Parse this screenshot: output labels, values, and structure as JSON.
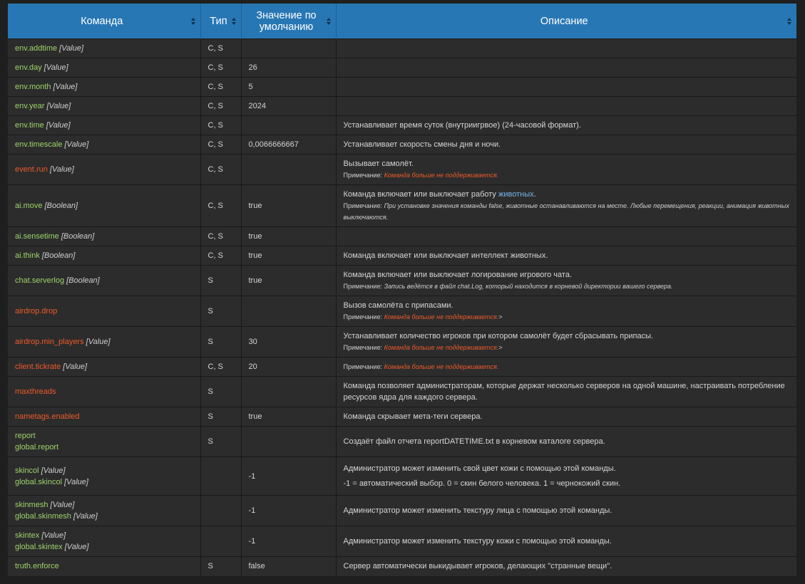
{
  "columns": [
    "Команда",
    "Тип",
    "Значение по умолчанию",
    "Описание"
  ],
  "rows": [
    {
      "h": 27,
      "cmds": [
        {
          "name": "env.addtime",
          "arg": "[Value]",
          "dep": false
        }
      ],
      "type": "C, S",
      "def": "",
      "desc": []
    },
    {
      "h": 27,
      "cmds": [
        {
          "name": "env.day",
          "arg": "[Value]",
          "dep": false
        }
      ],
      "type": "C, S",
      "def": "26",
      "desc": []
    },
    {
      "h": 27,
      "cmds": [
        {
          "name": "env.month",
          "arg": "[Value]",
          "dep": false
        }
      ],
      "type": "C, S",
      "def": "5",
      "desc": []
    },
    {
      "h": 27,
      "cmds": [
        {
          "name": "env.year",
          "arg": "[Value]",
          "dep": false
        }
      ],
      "type": "C, S",
      "def": "2024",
      "desc": []
    },
    {
      "h": 27,
      "cmds": [
        {
          "name": "env.time",
          "arg": "[Value]",
          "dep": false
        }
      ],
      "type": "C, S",
      "def": "",
      "desc": [
        {
          "t": "Устанавливает время суток (внутриигрвое) (24-часовой формат)."
        }
      ]
    },
    {
      "h": 27,
      "cmds": [
        {
          "name": "env.timescale",
          "arg": "[Value]",
          "dep": false
        }
      ],
      "type": "C, S",
      "def": "0,0066666667",
      "desc": [
        {
          "t": "Устанавливает скорость смены дня и ночи."
        }
      ]
    },
    {
      "h": 43,
      "cmds": [
        {
          "name": "event.run",
          "arg": "[Value]",
          "dep": true
        }
      ],
      "type": "C, S",
      "def": "",
      "desc": [
        {
          "t": "Вызывает самолёт."
        },
        {
          "note": "Примечание: ",
          "warn": "Команда больше не поддерживается.",
          "gt": ""
        }
      ]
    },
    {
      "h": 59,
      "cmds": [
        {
          "name": "ai.move",
          "arg": "[Boolean]",
          "dep": false
        }
      ],
      "type": "C, S",
      "def": "true",
      "desc": [
        {
          "t": "Команда включает или выключает работу ",
          "link": "животных",
          "after": "."
        },
        {
          "note": "Примечание: ",
          "it": "При установке значения команды false, животные останавливаются на месте. Любые перемещения, реакции, анимация животных выключаются."
        }
      ]
    },
    {
      "h": 27,
      "cmds": [
        {
          "name": "ai.sensetime",
          "arg": "[Boolean]",
          "dep": false
        }
      ],
      "type": "C, S",
      "def": "true",
      "desc": []
    },
    {
      "h": 27,
      "cmds": [
        {
          "name": "ai.think",
          "arg": "[Boolean]",
          "dep": false
        }
      ],
      "type": "C, S",
      "def": "true",
      "desc": [
        {
          "t": "Команда включает или выключает интеллект животных."
        }
      ]
    },
    {
      "h": 43,
      "cmds": [
        {
          "name": "chat.serverlog",
          "arg": "[Boolean]",
          "dep": false
        }
      ],
      "type": "S",
      "def": "true",
      "desc": [
        {
          "t": "Команда включает или выключает логирование игрового чата."
        },
        {
          "note": "Примечание: ",
          "it": "Запись ведётся в файл chat.Log, который находится в корневой директории вашего сервера."
        }
      ]
    },
    {
      "h": 43,
      "cmds": [
        {
          "name": "airdrop.drop",
          "arg": "",
          "dep": true
        }
      ],
      "type": "S",
      "def": "",
      "desc": [
        {
          "t": "Вызов самолёта с припасами."
        },
        {
          "note": "Примечание: ",
          "warn": "Команда больше не поддерживается.",
          "gt": ">"
        }
      ]
    },
    {
      "h": 43,
      "cmds": [
        {
          "name": "airdrop.min_players",
          "arg": "[Value]",
          "dep": true
        }
      ],
      "type": "S",
      "def": "30",
      "desc": [
        {
          "t": "Устанавливает количество игроков при котором самолёт будет сбрасывать припасы."
        },
        {
          "note": "Примечание: ",
          "warn": "Команда больше не поддерживается.",
          "gt": ">"
        }
      ]
    },
    {
      "h": 27,
      "cmds": [
        {
          "name": "client.tickrate",
          "arg": "[Value]",
          "dep": true
        }
      ],
      "type": "C, S",
      "def": "20",
      "desc": [
        {
          "note": "Примечание: ",
          "warn": "Команда больше не поддерживается.",
          "gt": ""
        }
      ]
    },
    {
      "h": 43,
      "cmds": [
        {
          "name": "maxthreads",
          "arg": "",
          "dep": true
        }
      ],
      "type": "S",
      "def": "",
      "desc": [
        {
          "t": "Команда позволяет администраторам, которые держат несколько серверов на одной машине, настраивать потребление ресурсов ядра для каждого сервера."
        }
      ]
    },
    {
      "h": 27,
      "cmds": [
        {
          "name": "nametags.enabled",
          "arg": "",
          "dep": true
        }
      ],
      "type": "S",
      "def": "true",
      "desc": [
        {
          "t": "Команда скрывает мета-теги сервера."
        }
      ]
    },
    {
      "h": 43,
      "cmds": [
        {
          "name": "report",
          "arg": "",
          "dep": false
        },
        {
          "name": "global.report",
          "arg": "",
          "dep": false
        }
      ],
      "type": "S",
      "def": "",
      "desc": [
        {
          "t": "Создаёт файл отчета reportDATETIME.txt в корневом каталоге сервера."
        }
      ]
    },
    {
      "h": 54,
      "cmds": [
        {
          "name": "skincol",
          "arg": "[Value]",
          "dep": false
        },
        {
          "name": "global.skincol",
          "arg": "[Value]",
          "dep": false
        }
      ],
      "type": "",
      "def": "-1",
      "desc": [
        {
          "t": "Администратор может изменить свой цвет кожи с помощью этой команды."
        },
        {
          "t": "-1 = автоматический выбор. 0 = скин белого человека. 1 = чернокожий скин.",
          "gap": true
        }
      ]
    },
    {
      "h": 43,
      "cmds": [
        {
          "name": "skinmesh",
          "arg": "[Value]",
          "dep": false
        },
        {
          "name": "global.skinmesh",
          "arg": "[Value]",
          "dep": false
        }
      ],
      "type": "",
      "def": "-1",
      "desc": [
        {
          "t": "Администратор может изменить текстуру лица с помощью этой команды."
        }
      ]
    },
    {
      "h": 43,
      "cmds": [
        {
          "name": "skintex",
          "arg": "[Value]",
          "dep": false
        },
        {
          "name": "global.skintex",
          "arg": "[Value]",
          "dep": false
        }
      ],
      "type": "",
      "def": "-1",
      "desc": [
        {
          "t": "Администратор может изменить текстуру кожи с помощью этой команды."
        }
      ]
    },
    {
      "h": 27,
      "cmds": [
        {
          "name": "truth.enforce",
          "arg": "",
          "dep": false
        }
      ],
      "type": "S",
      "def": "false",
      "desc": [
        {
          "t": "Сервер автоматически выкидывает игроков, делающих \"странные вещи\"."
        }
      ]
    }
  ]
}
